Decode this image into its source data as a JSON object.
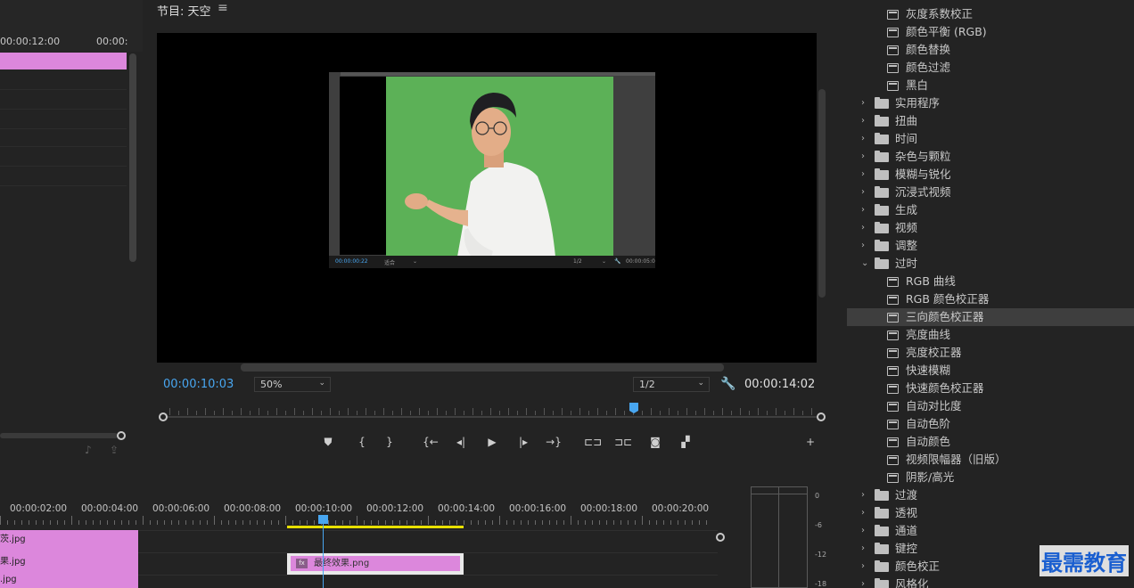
{
  "source_panel": {
    "timecodes": [
      "00:00:12:00",
      "00:00:"
    ]
  },
  "program_monitor": {
    "title": "节目: 天空",
    "menu_icon": "≡",
    "current_timecode": "00:00:10:03",
    "zoom": "50%",
    "resolution": "1/2",
    "duration_timecode": "00:00:14:02",
    "nested": {
      "timecode": "00:00:00:22",
      "zoom": "适合",
      "resolution": "1/2",
      "end_timecode": "00:00:05:0"
    },
    "transport_buttons": [
      {
        "name": "add-marker-button",
        "glyph": "⛊"
      },
      {
        "name": "mark-in-button",
        "glyph": "{"
      },
      {
        "name": "mark-out-button",
        "glyph": "}"
      },
      {
        "name": "go-to-in-button",
        "glyph": "{←"
      },
      {
        "name": "step-back-button",
        "glyph": "◂|"
      },
      {
        "name": "play-button",
        "glyph": "▶"
      },
      {
        "name": "step-forward-button",
        "glyph": "|▸"
      },
      {
        "name": "go-to-out-button",
        "glyph": "→}"
      },
      {
        "name": "lift-button",
        "glyph": "⊏⊐"
      },
      {
        "name": "extract-button",
        "glyph": "⊐⊏"
      },
      {
        "name": "export-frame-button",
        "glyph": "◙"
      },
      {
        "name": "comparison-view-button",
        "glyph": "▞"
      },
      {
        "name": "button-editor-button",
        "glyph": "+"
      }
    ]
  },
  "effects_panel": {
    "rows": [
      {
        "type": "item",
        "label": "灰度系数校正"
      },
      {
        "type": "item",
        "label": "颜色平衡 (RGB)"
      },
      {
        "type": "item",
        "label": "颜色替换"
      },
      {
        "type": "item",
        "label": "颜色过滤"
      },
      {
        "type": "item",
        "label": "黑白"
      },
      {
        "type": "cat",
        "label": "实用程序",
        "open": false
      },
      {
        "type": "cat",
        "label": "扭曲",
        "open": false
      },
      {
        "type": "cat",
        "label": "时间",
        "open": false
      },
      {
        "type": "cat",
        "label": "杂色与颗粒",
        "open": false
      },
      {
        "type": "cat",
        "label": "模糊与锐化",
        "open": false
      },
      {
        "type": "cat",
        "label": "沉浸式视频",
        "open": false
      },
      {
        "type": "cat",
        "label": "生成",
        "open": false
      },
      {
        "type": "cat",
        "label": "视频",
        "open": false
      },
      {
        "type": "cat",
        "label": "调整",
        "open": false
      },
      {
        "type": "cat",
        "label": "过时",
        "open": true
      },
      {
        "type": "item",
        "label": "RGB 曲线"
      },
      {
        "type": "item",
        "label": "RGB 颜色校正器"
      },
      {
        "type": "item",
        "label": "三向颜色校正器",
        "selected": true
      },
      {
        "type": "item",
        "label": "亮度曲线"
      },
      {
        "type": "item",
        "label": "亮度校正器"
      },
      {
        "type": "item",
        "label": "快速模糊"
      },
      {
        "type": "item",
        "label": "快速颜色校正器"
      },
      {
        "type": "item",
        "label": "自动对比度"
      },
      {
        "type": "item",
        "label": "自动色阶"
      },
      {
        "type": "item",
        "label": "自动颜色"
      },
      {
        "type": "item",
        "label": "视频限幅器（旧版）"
      },
      {
        "type": "item",
        "label": "阴影/高光"
      },
      {
        "type": "cat",
        "label": "过渡",
        "open": false
      },
      {
        "type": "cat",
        "label": "透视",
        "open": false
      },
      {
        "type": "cat",
        "label": "通道",
        "open": false
      },
      {
        "type": "cat",
        "label": "键控",
        "open": false
      },
      {
        "type": "cat",
        "label": "颜色校正",
        "open": false
      },
      {
        "type": "cat",
        "label": "风格化",
        "open": false
      }
    ],
    "watermark": "最需教育"
  },
  "timeline": {
    "ruler_timecodes": [
      "00:00:02:00",
      "00:00:04:00",
      "00:00:06:00",
      "00:00:08:00",
      "00:00:10:00",
      "00:00:12:00",
      "00:00:14:00",
      "00:00:16:00",
      "00:00:18:00",
      "00:00:20:00"
    ],
    "clips": [
      "茨.jpg",
      "果.jpg",
      ".jpg"
    ],
    "final_clip": {
      "badge": "fx",
      "label": "最终效果.png"
    }
  },
  "audio_meters": {
    "labels": [
      "0",
      "-6",
      "-12",
      "-18"
    ]
  },
  "colors": {
    "accent_blue": "#48a6f0",
    "clip_pink": "#dc87dc",
    "green_screen": "#5cb157",
    "work_area": "#e8e000"
  }
}
